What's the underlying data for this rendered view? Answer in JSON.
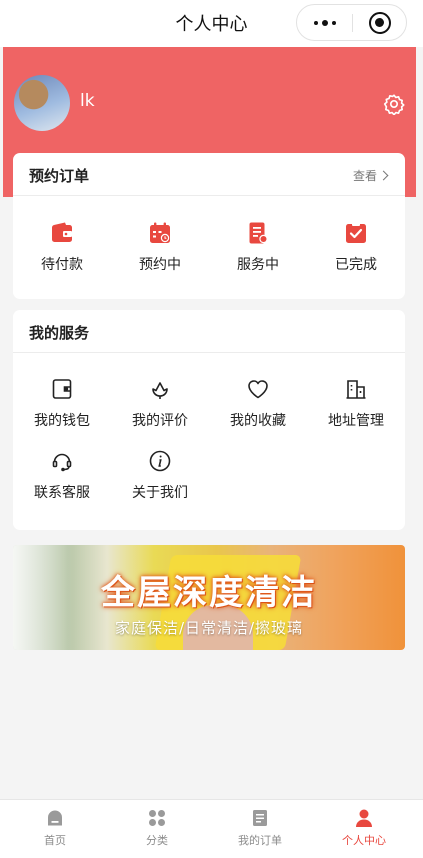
{
  "title": "个人中心",
  "user": {
    "name": "lk"
  },
  "orders": {
    "title": "预约订单",
    "more": "查看",
    "items": [
      {
        "label": "待付款",
        "icon": "wallet-icon"
      },
      {
        "label": "预约中",
        "icon": "calendar-icon"
      },
      {
        "label": "服务中",
        "icon": "document-icon"
      },
      {
        "label": "已完成",
        "icon": "clipboard-check-icon"
      }
    ]
  },
  "services": {
    "title": "我的服务",
    "items": [
      {
        "label": "我的钱包",
        "icon": "wallet-outline-icon"
      },
      {
        "label": "我的评价",
        "icon": "lotus-icon"
      },
      {
        "label": "我的收藏",
        "icon": "heart-icon"
      },
      {
        "label": "地址管理",
        "icon": "building-icon"
      },
      {
        "label": "联系客服",
        "icon": "headset-icon"
      },
      {
        "label": "关于我们",
        "icon": "info-icon"
      }
    ]
  },
  "banner": {
    "headline": "全屋深度清洁",
    "subtitle": "家庭保洁/日常清洁/擦玻璃"
  },
  "tabbar": {
    "items": [
      {
        "label": "首页",
        "icon": "home-icon",
        "active": false
      },
      {
        "label": "分类",
        "icon": "category-icon",
        "active": false
      },
      {
        "label": "我的订单",
        "icon": "order-list-icon",
        "active": false
      },
      {
        "label": "个人中心",
        "icon": "person-icon",
        "active": true
      }
    ]
  },
  "colors": {
    "brand": "#ef6464",
    "accent": "#e8483f",
    "tab_inactive": "#8c8c8c"
  }
}
